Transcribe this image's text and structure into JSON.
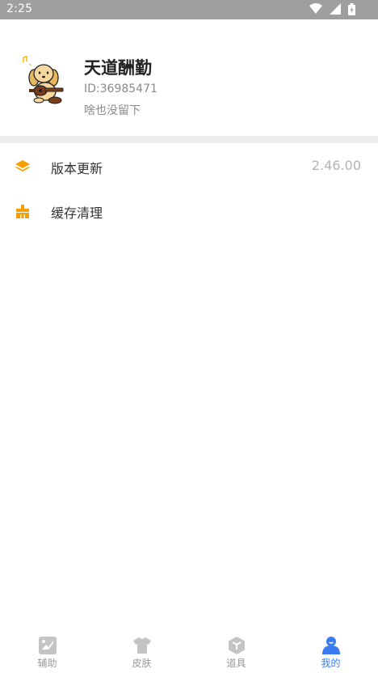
{
  "status_bar": {
    "time": "2:25"
  },
  "profile": {
    "name": "天道酬勤",
    "id": "ID:36985471",
    "signature": "啥也没留下"
  },
  "menu": [
    {
      "label": "版本更新",
      "value": "2.46.00",
      "icon": "layers-icon"
    },
    {
      "label": "缓存清理",
      "value": "",
      "icon": "broom-icon"
    }
  ],
  "bottom_nav": [
    {
      "label": "辅助",
      "icon": "image-icon",
      "active": false
    },
    {
      "label": "皮肤",
      "icon": "shirt-icon",
      "active": false
    },
    {
      "label": "道具",
      "icon": "box-icon",
      "active": false
    },
    {
      "label": "我的",
      "icon": "person-icon",
      "active": true
    }
  ],
  "colors": {
    "accent": "#3a7cf0",
    "menu_icon": "#f5a000",
    "nav_inactive": "#c4c4c4",
    "status_bar": "#9e9e9e"
  }
}
